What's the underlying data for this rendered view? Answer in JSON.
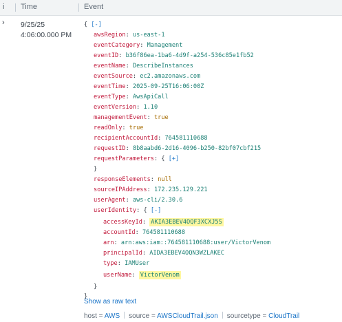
{
  "header": {
    "info_icon": "info-icon",
    "time_label": "Time",
    "event_label": "Event"
  },
  "row": {
    "expand_icon": "chevron-right-icon",
    "date": "9/25/25",
    "time": "4:06:00.000 PM"
  },
  "event": {
    "open_brace": "{",
    "collapse_label": "[-]",
    "expand_label": "[+]",
    "close_brace": "}",
    "fields": {
      "awsRegion": {
        "key": "awsRegion",
        "value": "us-east-1"
      },
      "eventCategory": {
        "key": "eventCategory",
        "value": "Management"
      },
      "eventID": {
        "key": "eventID",
        "value": "b36f86ea-1ba6-4d9f-a254-536c85e1fb52"
      },
      "eventName": {
        "key": "eventName",
        "value": "DescribeInstances"
      },
      "eventSource": {
        "key": "eventSource",
        "value": "ec2.amazonaws.com"
      },
      "eventTime": {
        "key": "eventTime",
        "value": "2025-09-25T16:06:00Z"
      },
      "eventType": {
        "key": "eventType",
        "value": "AwsApiCall"
      },
      "eventVersion": {
        "key": "eventVersion",
        "value": "1.10"
      },
      "managementEvent": {
        "key": "managementEvent",
        "value": "true"
      },
      "readOnly": {
        "key": "readOnly",
        "value": "true"
      },
      "recipientAccountId": {
        "key": "recipientAccountId",
        "value": "764581110688"
      },
      "requestID": {
        "key": "requestID",
        "value": "8b8aabd6-2d16-4096-b250-82bf07cbf215"
      },
      "requestParameters": {
        "key": "requestParameters",
        "value": "{"
      },
      "responseElements": {
        "key": "responseElements",
        "value": "null"
      },
      "sourceIPAddress": {
        "key": "sourceIPAddress",
        "value": "172.235.129.221"
      },
      "userAgent": {
        "key": "userAgent",
        "value": "aws-cli/2.30.6"
      },
      "userIdentity": {
        "key": "userIdentity",
        "value": "{"
      },
      "accessKeyId": {
        "key": "accessKeyId",
        "value": "AKIA3EBEV4OQF3XCXJ5S"
      },
      "accountId": {
        "key": "accountId",
        "value": "764581110688"
      },
      "arn": {
        "key": "arn",
        "value": "arn:aws:iam::764581110688:user/VictorVenom"
      },
      "principalId": {
        "key": "principalId",
        "value": "AIDA3EBEV4OQN3WZLAKEC"
      },
      "type": {
        "key": "type",
        "value": "IAMUser"
      },
      "userName": {
        "key": "userName",
        "value": "VictorVenom"
      }
    }
  },
  "raw_link": "Show as raw text",
  "meta": {
    "host_label": "host = ",
    "host_value": "AWS",
    "source_label": "source = ",
    "source_value": "AWSCloudTrail.json",
    "sourcetype_label": "sourcetype = ",
    "sourcetype_value": "CloudTrail"
  },
  "colors": {
    "key": "#c1193b",
    "string": "#1a7f74",
    "keyword": "#a66b00",
    "link": "#1a74c7",
    "highlight": "#fff7a0"
  }
}
